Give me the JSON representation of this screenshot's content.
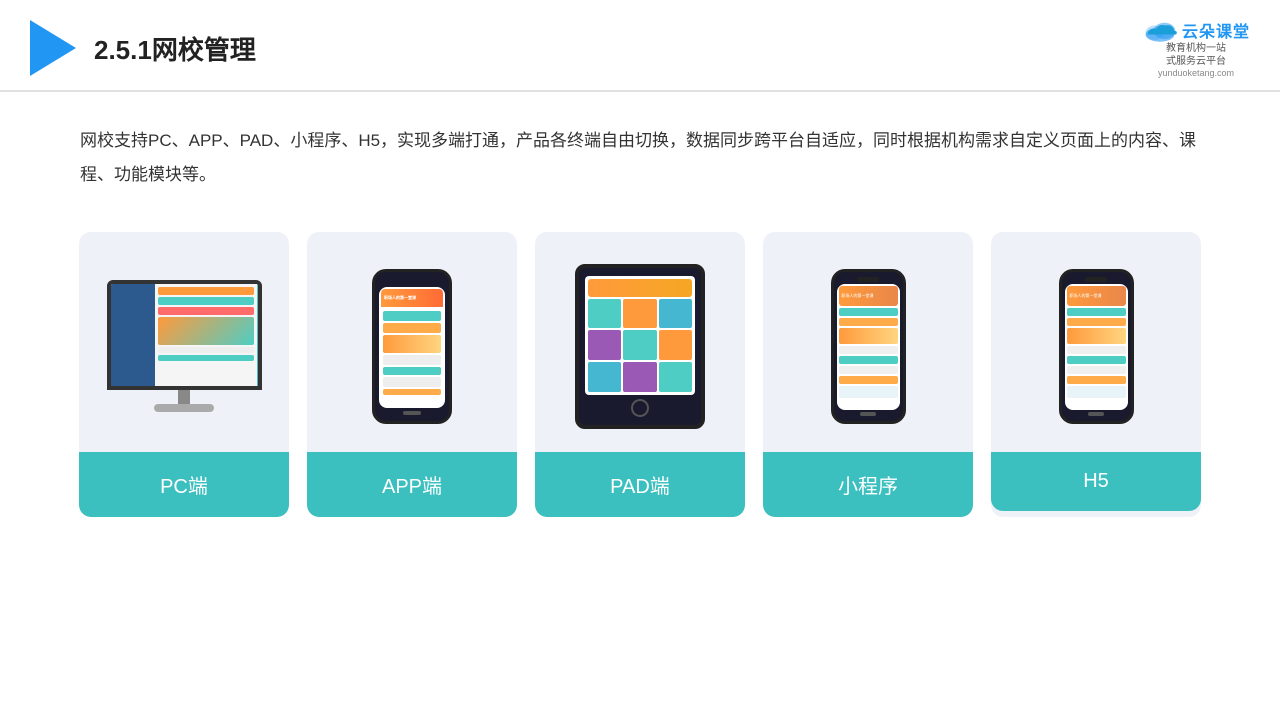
{
  "header": {
    "title": "2.5.1网校管理",
    "brand": {
      "name_cn": "云朵课堂",
      "tagline_line1": "教育机构一站",
      "tagline_line2": "式服务云平台",
      "url": "yunduoketang.com"
    }
  },
  "description": {
    "text": "网校支持PC、APP、PAD、小程序、H5，实现多端打通，产品各终端自由切换，数据同步跨平台自适应，同时根据机构需求自定义页面上的内容、课程、功能模块等。"
  },
  "cards": [
    {
      "id": "pc",
      "label": "PC端"
    },
    {
      "id": "app",
      "label": "APP端"
    },
    {
      "id": "pad",
      "label": "PAD端"
    },
    {
      "id": "miniapp",
      "label": "小程序"
    },
    {
      "id": "h5",
      "label": "H5"
    }
  ],
  "colors": {
    "accent": "#3cbfbf",
    "header_border": "#e0e0e0",
    "card_bg": "#eef2f8",
    "triangle_blue": "#2196f3"
  }
}
